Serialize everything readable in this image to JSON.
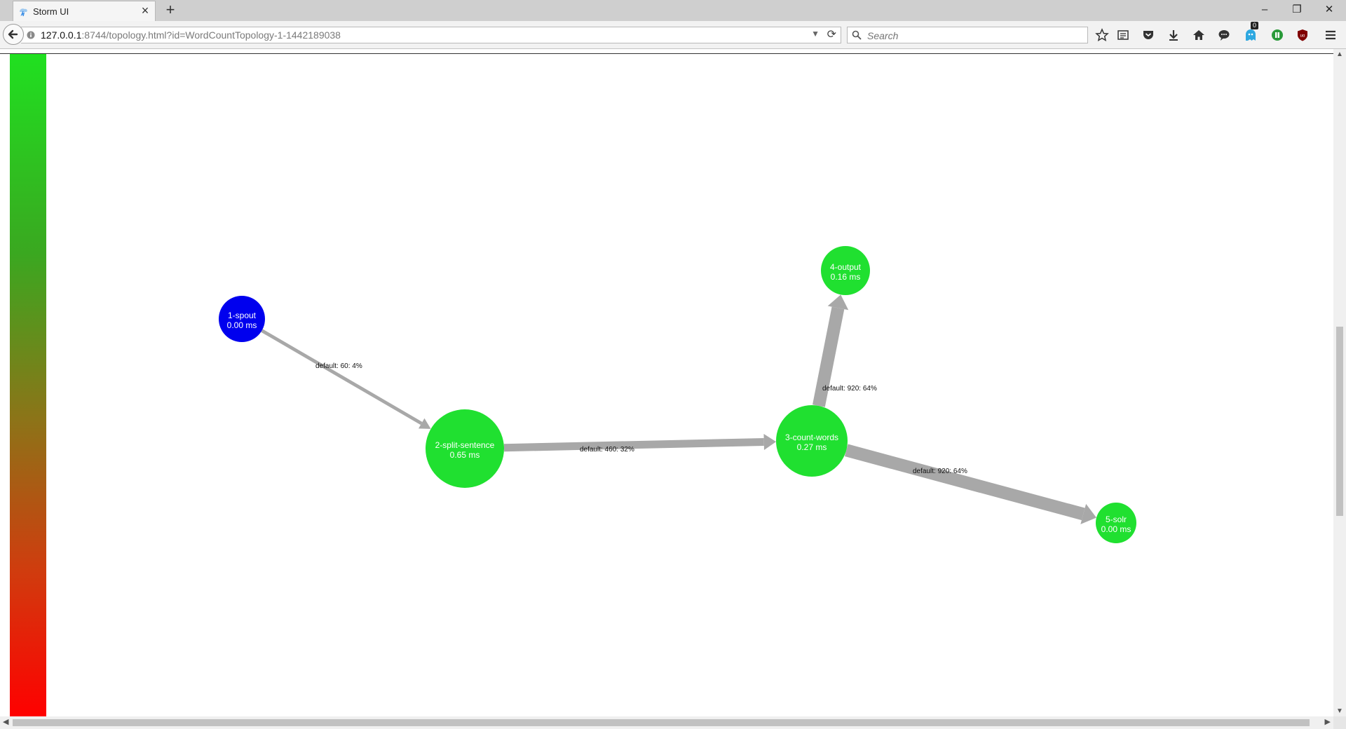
{
  "browser": {
    "tab_title": "Storm UI",
    "new_tab": "+",
    "close_tab": "×",
    "url_host": "127.0.0.1",
    "url_rest": ":8744/topology.html?id=WordCountTopology-1-1442189038",
    "search_placeholder": "Search",
    "notification_count": "0",
    "window_minimize": "–",
    "window_restore": "❐",
    "window_close": "✕",
    "colors": {
      "accent_blue": "#3a8ee6",
      "tabbar": "#cfcfcf"
    }
  },
  "graph": {
    "legend_colors": {
      "top": "#20e020",
      "bottom": "#ff0000"
    },
    "nodes": [
      {
        "id": "1-spout",
        "label": "1-spout",
        "latency": "0.00 ms",
        "color": "#0000ee"
      },
      {
        "id": "2-split-sentence",
        "label": "2-split-sentence",
        "latency": "0.65 ms",
        "color": "#20e030"
      },
      {
        "id": "3-count-words",
        "label": "3-count-words",
        "latency": "0.27 ms",
        "color": "#20e030"
      },
      {
        "id": "4-output",
        "label": "4-output",
        "latency": "0.16 ms",
        "color": "#20e030"
      },
      {
        "id": "5-solr",
        "label": "5-solr",
        "latency": "0.00 ms",
        "color": "#20e030"
      }
    ],
    "edges": [
      {
        "from": "1-spout",
        "to": "2-split-sentence",
        "label": "default: 60: 4%",
        "share": 0.04
      },
      {
        "from": "2-split-sentence",
        "to": "3-count-words",
        "label": "default: 460: 32%",
        "share": 0.32
      },
      {
        "from": "3-count-words",
        "to": "4-output",
        "label": "default: 920: 64%",
        "share": 0.64
      },
      {
        "from": "3-count-words",
        "to": "5-solr",
        "label": "default: 920: 64%",
        "share": 0.64
      }
    ]
  }
}
